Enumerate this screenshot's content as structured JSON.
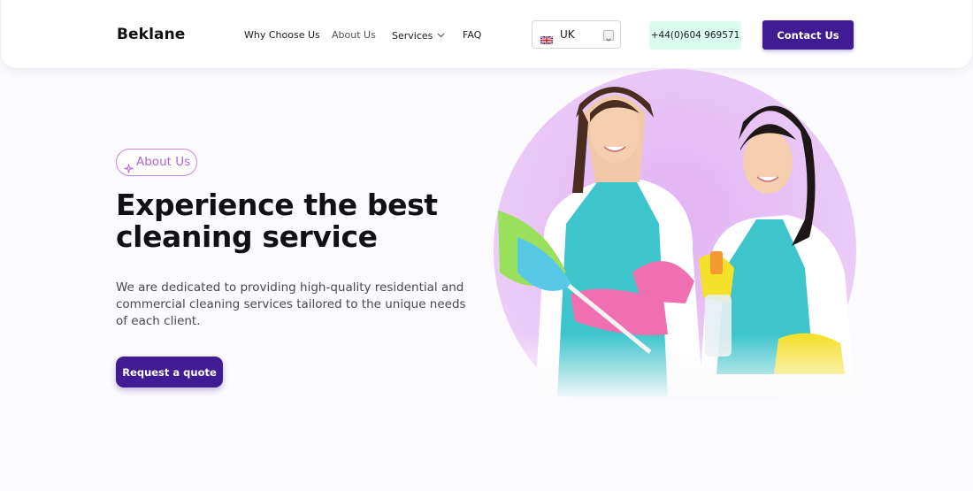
{
  "header": {
    "logo": "Beklane",
    "nav": [
      {
        "label": "Why Choose Us"
      },
      {
        "label": "About Us"
      },
      {
        "label": "Services"
      },
      {
        "label": "FAQ"
      }
    ],
    "language": {
      "label": "UK",
      "flag_icon": "uk-flag-icon"
    },
    "phone": "+44(0)604 969571",
    "contact_label": "Contact Us"
  },
  "hero": {
    "badge": "About Us",
    "title": "Experience the best cleaning service",
    "description": "We are dedicated to providing high-quality residential and commercial cleaning services tailored to the unique needs of each client.",
    "cta_label": "Request a quote"
  },
  "colors": {
    "primary": "#3f1c94",
    "badge_accent": "#b063d9",
    "phone_bg": "#dbfbef",
    "hero_circle": "#e6bcf5",
    "apron": "#3fc6cc"
  }
}
